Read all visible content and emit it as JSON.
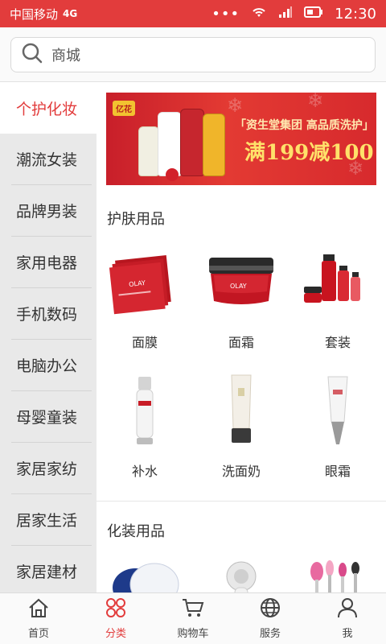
{
  "status_bar": {
    "carrier": "中国移动",
    "network": "4G",
    "time": "12:30"
  },
  "search": {
    "placeholder": "商城"
  },
  "sidebar": {
    "items": [
      {
        "label": "个护化妆",
        "active": true
      },
      {
        "label": "潮流女装"
      },
      {
        "label": "品牌男装"
      },
      {
        "label": "家用电器"
      },
      {
        "label": "手机数码"
      },
      {
        "label": "电脑办公"
      },
      {
        "label": "母婴童装"
      },
      {
        "label": "家居家纺"
      },
      {
        "label": "居家生活"
      },
      {
        "label": "家居建材"
      }
    ]
  },
  "banner": {
    "badge": "亿花",
    "line1": "「资生堂集团 高品质洗护」",
    "line2": "满199减100"
  },
  "sections": [
    {
      "title": "护肤用品",
      "items": [
        {
          "label": "面膜",
          "icon": "face-mask-icon"
        },
        {
          "label": "面霜",
          "icon": "face-cream-icon"
        },
        {
          "label": "套装",
          "icon": "skincare-set-icon"
        },
        {
          "label": "补水",
          "icon": "hydrating-lotion-icon"
        },
        {
          "label": "洗面奶",
          "icon": "facial-cleanser-icon"
        },
        {
          "label": "眼霜",
          "icon": "eye-cream-icon"
        }
      ]
    },
    {
      "title": "化装用品",
      "items": [
        {
          "label": "",
          "icon": "puff-icon"
        },
        {
          "label": "",
          "icon": "cleansing-brush-icon"
        },
        {
          "label": "",
          "icon": "makeup-brushes-icon"
        }
      ]
    }
  ],
  "tab_bar": {
    "tabs": [
      {
        "label": "首页",
        "icon": "home-icon"
      },
      {
        "label": "分类",
        "icon": "category-icon",
        "active": true
      },
      {
        "label": "购物车",
        "icon": "cart-icon"
      },
      {
        "label": "服务",
        "icon": "service-icon"
      },
      {
        "label": "我",
        "icon": "user-icon"
      }
    ]
  },
  "colors": {
    "accent": "#e23c3c",
    "sidebar_bg": "#e9e9e9"
  }
}
